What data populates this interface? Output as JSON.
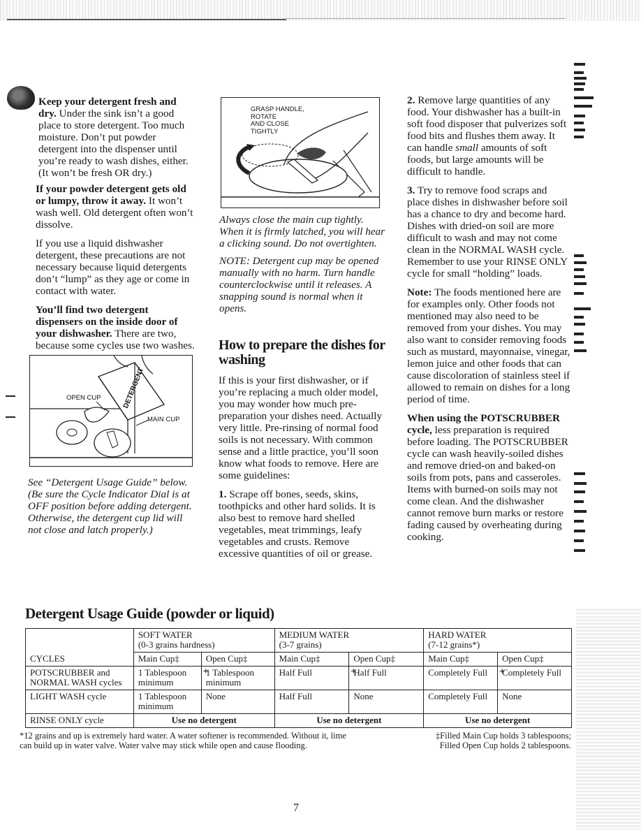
{
  "left_column": {
    "para1_bold": "Keep your detergent fresh and dry.",
    "para1_text": " Under the sink isn’t a good place to store detergent. Too much moisture. Don’t put powder detergent into the dispenser until you’re ready to wash dishes, either. (It won’t be fresh OR dry.)",
    "para2_bold": "If your powder detergent gets old or lumpy, throw it away.",
    "para2_text": " It won’t wash well. Old detergent often won’t dissolve.",
    "para3_text": "If you use a liquid dishwasher detergent, these precautions are not necessary because liquid detergents don’t “lump” as they age or come in contact with water.",
    "para4_bold": "You’ll find two detergent dispensers on the inside door of your dishwasher.",
    "para4_text": " There are two, because some cycles use two washes.",
    "figure": {
      "label_open_cup": "OPEN CUP",
      "label_main_cup": "MAIN CUP",
      "label_box": "DETERGENT"
    },
    "caption": "See “Detergent Usage Guide” below. (Be sure the Cycle Indicator Dial is at OFF position before adding detergent. Otherwise, the detergent cup lid will not close and latch properly.)"
  },
  "middle_column": {
    "figure": {
      "label": [
        "GRASP HANDLE,",
        "ROTATE",
        "AND CLOSE",
        "TIGHTLY"
      ]
    },
    "caption1": "Always close the main cup tightly. When it is firmly latched, you will hear a clicking sound. Do not overtighten.",
    "caption2": "NOTE: Detergent cup may be opened manually with no harm. Turn handle counterclockwise until it releases. A snapping sound is normal when it opens.",
    "section_title": "How to prepare the dishes for washing",
    "intro": "If this is your first dishwasher, or if you’re replacing a much older model, you may wonder how much pre-preparation your dishes need. Actually very little. Pre-rinsing of normal food soils is not necessary. With common sense and a little practice, you’ll soon know what foods to remove. Here are some guidelines:",
    "step1_num": "1.",
    "step1_text": " Scrape off bones, seeds, skins, toothpicks and other hard solids. It is also best to remove hard shelled vegetables, meat trimmings, leafy vegetables and crusts. Remove excessive quantities of oil or grease."
  },
  "right_column": {
    "step2_num": "2.",
    "step2_text_a": " Remove large quantities of any food. Your dishwasher has a built-in soft food disposer that pulverizes soft food bits and flushes them away. It can handle ",
    "step2_italic": "small",
    "step2_text_b": " amounts of soft foods, but large amounts will be difficult to handle.",
    "step3_num": "3.",
    "step3_text": " Try to remove food scraps and place dishes in dishwasher before soil has a chance to dry and become hard. Dishes with dried-on soil are more difficult to wash and may not come clean in the NORMAL WASH cycle. Remember to use your RINSE ONLY cycle for small “holding” loads.",
    "note_bold": "Note:",
    "note_text": " The foods mentioned here are for examples only. Other foods not mentioned may also need to be removed from your dishes. You may also want to consider removing foods such as mustard, mayonnaise, vinegar, lemon juice and other foods that can cause discoloration of stainless steel if allowed to remain on dishes for a long period of time.",
    "pot_bold": "When using the POTSCRUBBER cycle,",
    "pot_text": " less preparation is required before loading. The POTSCRUBBER cycle can wash heavily-soiled dishes and remove dried-on and baked-on soils from pots, pans and casseroles. Items with burned-on soils may not come clean. And the dishwasher cannot remove burn marks or restore fading caused by overheating during cooking."
  },
  "guide": {
    "title": "Detergent Usage Guide (powder or liquid)",
    "cycles_header": "CYCLES",
    "water_types": [
      {
        "name": "SOFT WATER",
        "range": "(0-3 grains hardness)"
      },
      {
        "name": "MEDIUM WATER",
        "range": "(3-7 grains)"
      },
      {
        "name": "HARD WATER",
        "range": "(7-12 grains*)"
      }
    ],
    "cup_headers": [
      "Main Cup‡",
      "Open Cup‡"
    ],
    "plus_sign": "+",
    "rows": [
      {
        "cycle": "POTSCRUBBER and NORMAL WASH cycles",
        "cells": [
          "1 Tablespoon minimum",
          "1 Tablespoon minimum",
          "Half Full",
          "Half Full",
          "Completely Full",
          "Completely Full"
        ]
      },
      {
        "cycle": "LIGHT WASH cycle",
        "cells": [
          "1 Tablespoon minimum",
          "None",
          "Half Full",
          "None",
          "Completely Full",
          "None"
        ]
      },
      {
        "cycle": "RINSE ONLY cycle",
        "merged": [
          "Use no detergent",
          "Use no detergent",
          "Use no detergent"
        ]
      }
    ],
    "footnote_left": "*12 grains and up is extremely hard water. A water softener is recommended. Without it, lime can build up in water valve. Water valve may stick while open and cause flooding.",
    "footnote_right_1": "‡Filled Main Cup holds 3 tablespoons;",
    "footnote_right_2": "Filled Open Cup holds 2 tablespoons."
  },
  "page_number": "7"
}
